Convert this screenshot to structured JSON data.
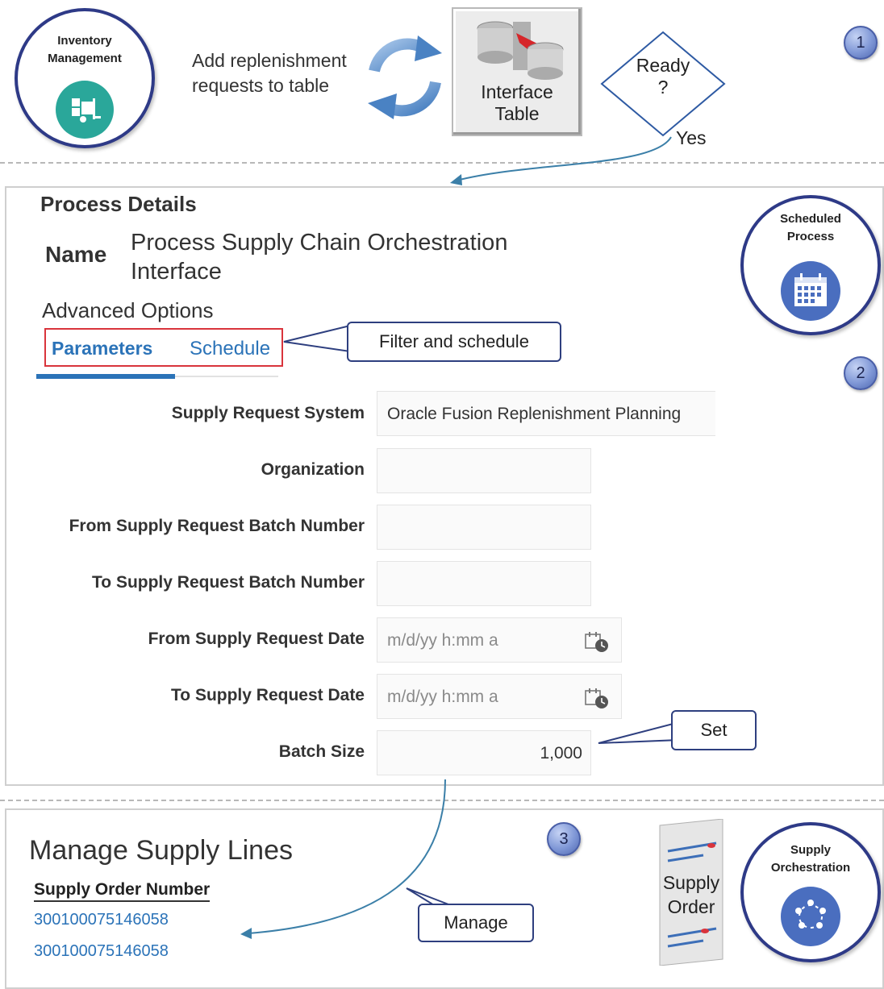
{
  "section1": {
    "inventory_circle": {
      "line1": "Inventory",
      "line2": "Management"
    },
    "add_text_line1": "Add replenishment",
    "add_text_line2": "requests to table",
    "interface_box": {
      "line1": "Interface",
      "line2": "Table"
    },
    "decision": {
      "line1": "Ready",
      "line2": "?"
    },
    "yes_label": "Yes",
    "step_number": "1"
  },
  "section2": {
    "heading": "Process Details",
    "name_label": "Name",
    "name_value_line1": "Process Supply Chain Orchestration",
    "name_value_line2": "Interface",
    "advanced_options": "Advanced Options",
    "tabs": [
      {
        "label": "Parameters",
        "selected": true
      },
      {
        "label": "Schedule",
        "selected": false
      }
    ],
    "tabs_callout": "Filter and schedule",
    "scheduled_circle": {
      "line1": "Scheduled",
      "line2": "Process"
    },
    "step_number": "2",
    "fields": {
      "supply_request_system": {
        "label": "Supply Request System",
        "value": "Oracle Fusion Replenishment Planning"
      },
      "organization": {
        "label": "Organization",
        "value": ""
      },
      "from_batch": {
        "label": "From Supply Request Batch Number",
        "value": ""
      },
      "to_batch": {
        "label": "To Supply Request Batch Number",
        "value": ""
      },
      "from_date": {
        "label": "From Supply Request Date",
        "placeholder": "m/d/yy h:mm a"
      },
      "to_date": {
        "label": "To Supply Request Date",
        "placeholder": "m/d/yy h:mm a"
      },
      "batch_size": {
        "label": "Batch Size",
        "value": "1,000"
      }
    },
    "set_callout": "Set"
  },
  "section3": {
    "heading": "Manage Supply Lines",
    "column_header": "Supply Order Number",
    "rows": [
      "300100075146058",
      "300100075146058"
    ],
    "manage_callout": "Manage",
    "step_number": "3",
    "supply_order_doc": {
      "line1": "Supply",
      "line2": "Order"
    },
    "orchestration_circle": {
      "line1": "Supply",
      "line2": "Orchestration"
    }
  },
  "colors": {
    "accent_blue": "#2b73b8",
    "circle_border": "#2e3a87",
    "teal_icon": "#2aa79a",
    "blue_icon": "#4a6ebf",
    "highlight_red": "#d9343c"
  }
}
